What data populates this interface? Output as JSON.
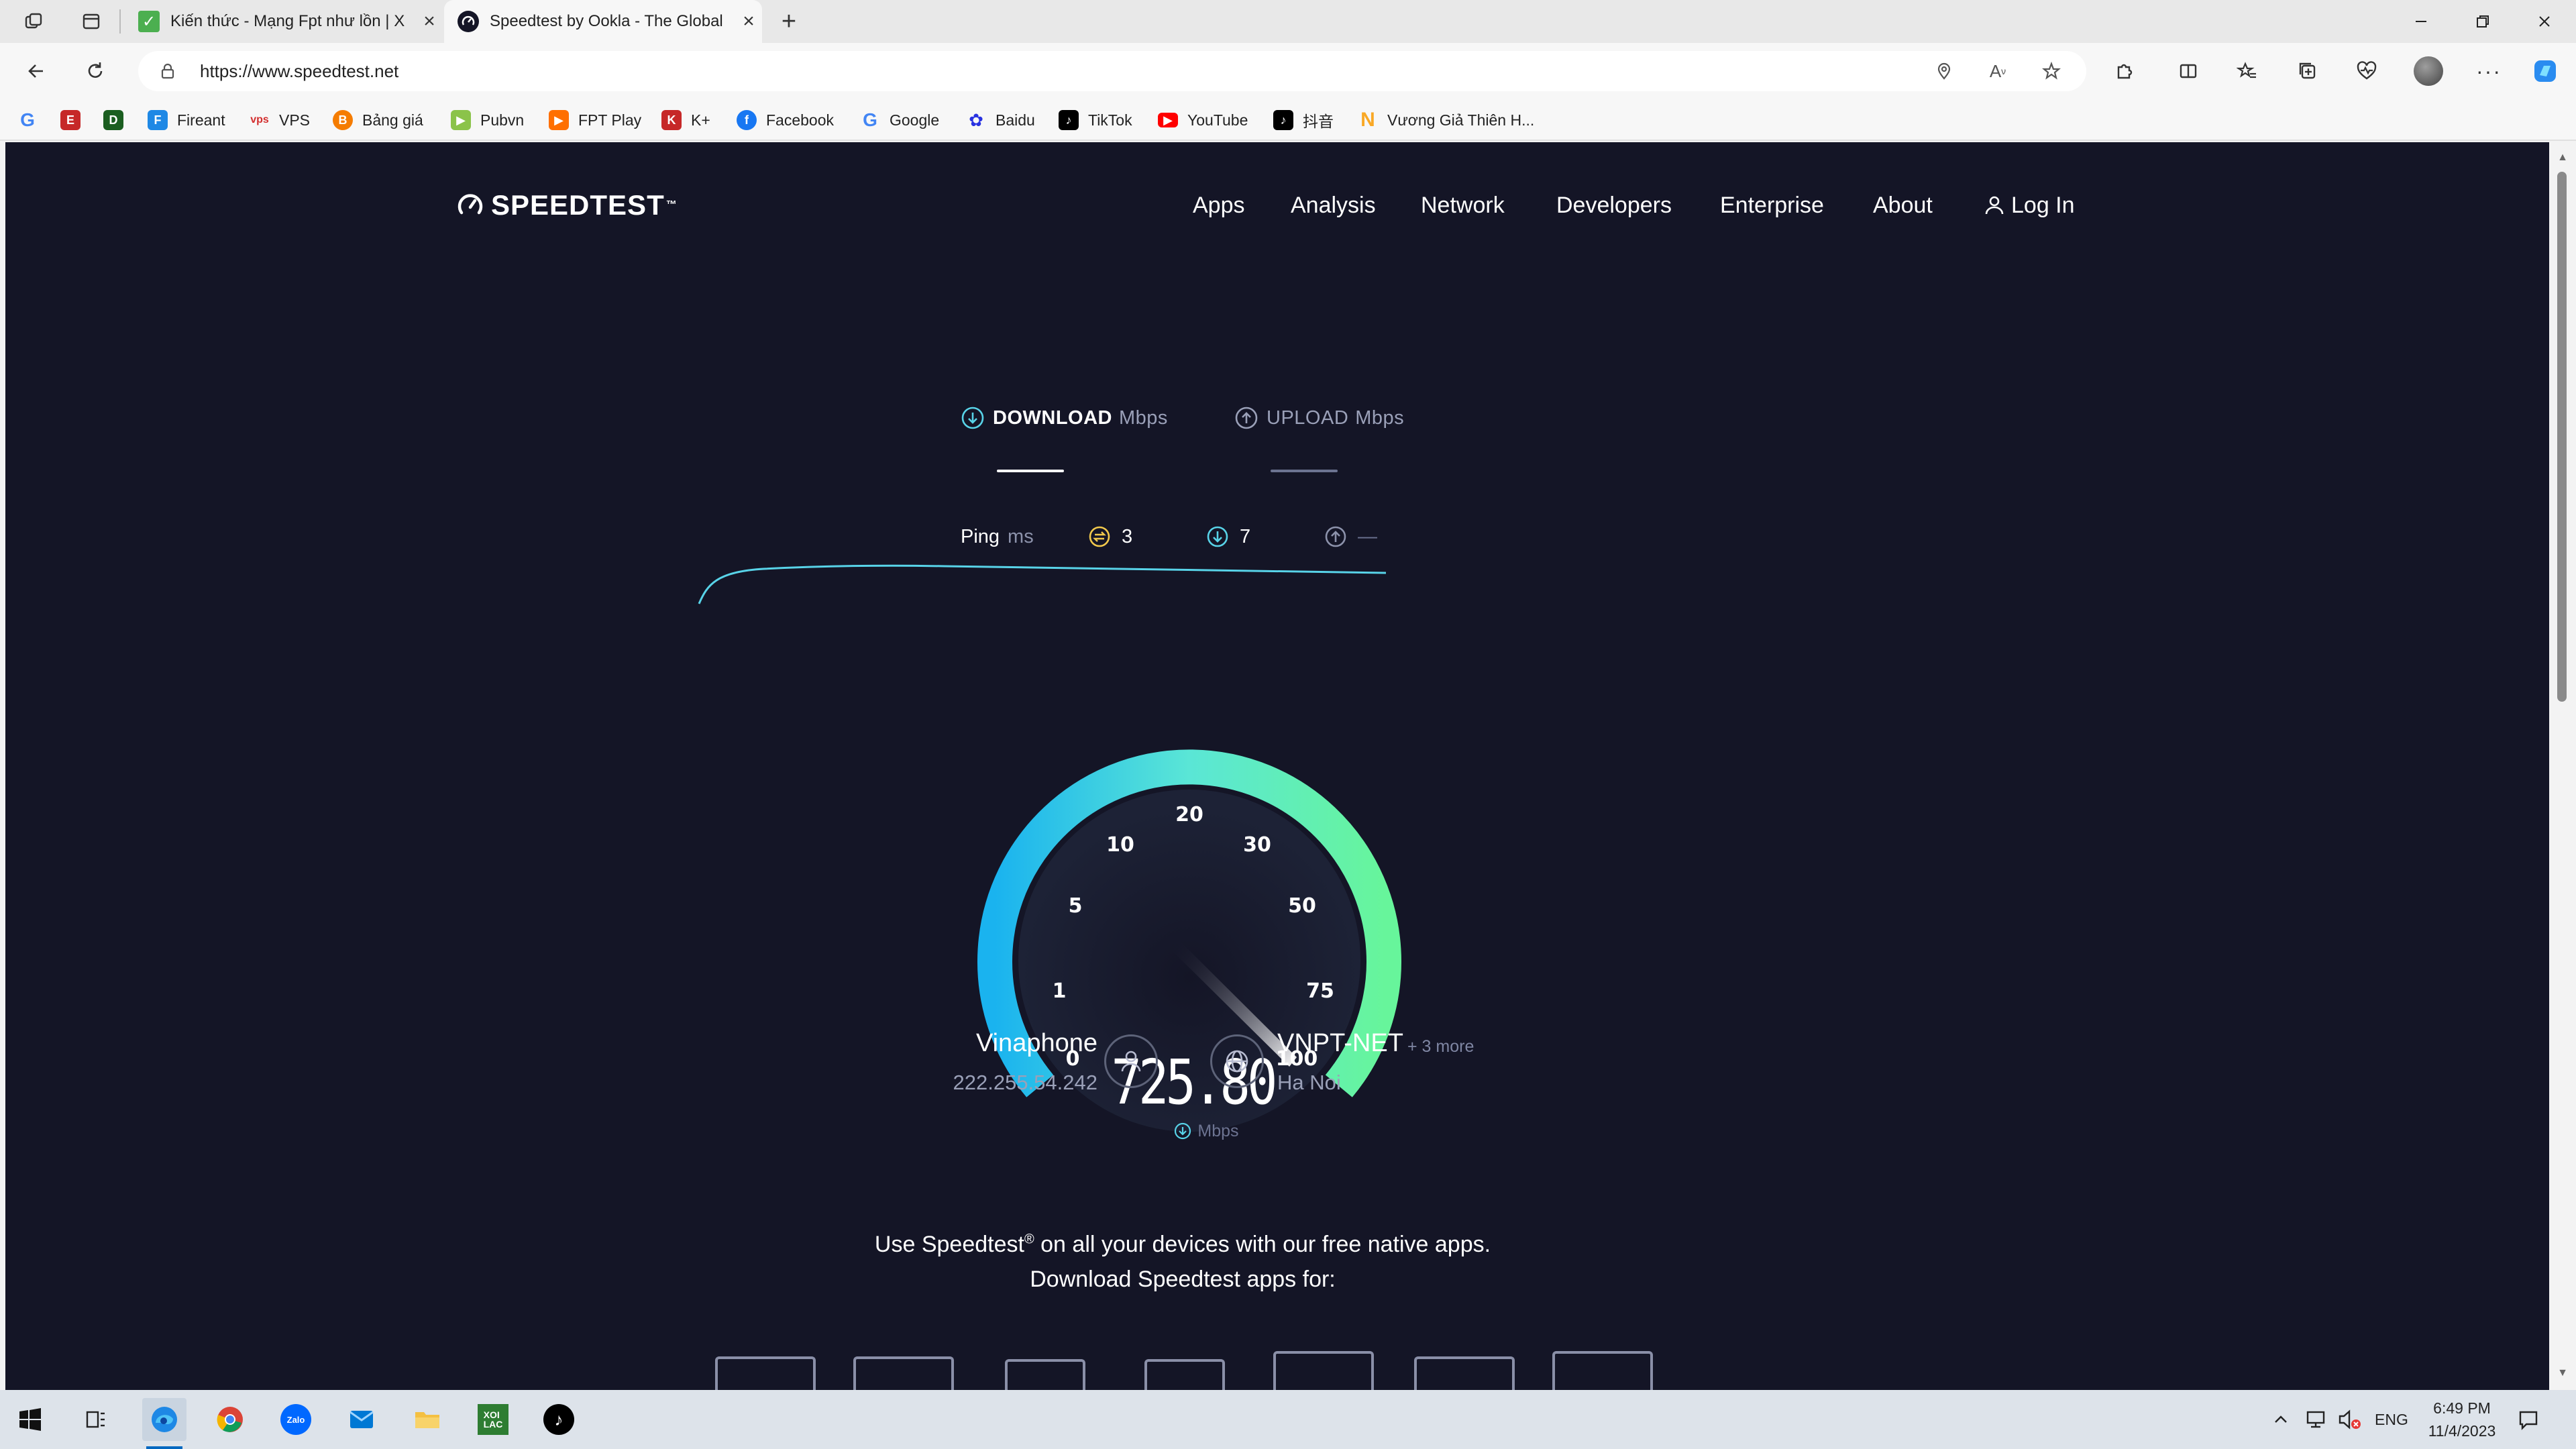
{
  "browser": {
    "tabs": [
      {
        "title": "Kiến thức - Mạng Fpt như lồn | X",
        "active": false
      },
      {
        "title": "Speedtest by Ookla - The Global",
        "active": true
      }
    ],
    "new_tab_symbol": "+",
    "close_symbol": "×",
    "url": "https://www.speedtest.net",
    "bookmarks": [
      {
        "label": "",
        "icon": "google-icon",
        "color": "#4285f4"
      },
      {
        "label": "",
        "icon": "bookmark-red-icon",
        "color": "#c62828"
      },
      {
        "label": "",
        "icon": "bookmark-d-icon",
        "color": "#1b5e20"
      },
      {
        "label": "Fireant",
        "icon": "fireant-icon",
        "color": "#1e88e5"
      },
      {
        "label": "VPS",
        "icon": "vps-icon",
        "color": "#d32f2f"
      },
      {
        "label": "Bảng giá",
        "icon": "bang-gia-icon",
        "color": "#f57c00"
      },
      {
        "label": "Pubvn",
        "icon": "pubvn-icon",
        "color": "#8bc34a"
      },
      {
        "label": "FPT Play",
        "icon": "fpt-play-icon",
        "color": "#ff6f00"
      },
      {
        "label": "K+",
        "icon": "kplus-icon",
        "color": "#c62828"
      },
      {
        "label": "Facebook",
        "icon": "facebook-icon",
        "color": "#1877f2"
      },
      {
        "label": "Google",
        "icon": "google-icon",
        "color": "#4285f4"
      },
      {
        "label": "Baidu",
        "icon": "baidu-icon",
        "color": "#2932e1"
      },
      {
        "label": "TikTok",
        "icon": "tiktok-icon",
        "color": "#000000"
      },
      {
        "label": "YouTube",
        "icon": "youtube-icon",
        "color": "#ff0000"
      },
      {
        "label": "抖音",
        "icon": "douyin-icon",
        "color": "#000000"
      },
      {
        "label": "Vương Giả Thiên H...",
        "icon": "vuong-gia-icon",
        "color": "#f9a825"
      }
    ]
  },
  "speedtest": {
    "logo": "SPEEDTEST",
    "nav": [
      "Apps",
      "Analysis",
      "Network",
      "Developers",
      "Enterprise",
      "About"
    ],
    "login": "Log In",
    "download_label": "DOWNLOAD",
    "upload_label": "UPLOAD",
    "unit": "Mbps",
    "ping_label": "Ping",
    "ping_unit": "ms",
    "ping_idle": "3",
    "ping_download": "7",
    "ping_upload": "—",
    "gauge_ticks": [
      "0",
      "1",
      "5",
      "10",
      "20",
      "30",
      "50",
      "75",
      "100"
    ],
    "speed_value": "725.80",
    "speed_unit": "Mbps",
    "isp_name": "Vinaphone",
    "isp_ip": "222.255.54.242",
    "server_name": "VNPT-NET",
    "server_more": "+ 3 more",
    "server_location": "Ha Noi",
    "promo_line1_pre": "Use Speedtest",
    "promo_reg": "®",
    "promo_line1_post": " on all your devices with our free native apps.",
    "promo_line2": "Download Speedtest apps for:",
    "accent_download": "#58d3e8",
    "accent_gauge_start": "#1ab3ef",
    "accent_gauge_end": "#67f59b"
  },
  "taskbar": {
    "lang": "ENG",
    "time": "6:49 PM",
    "date": "11/4/2023"
  }
}
